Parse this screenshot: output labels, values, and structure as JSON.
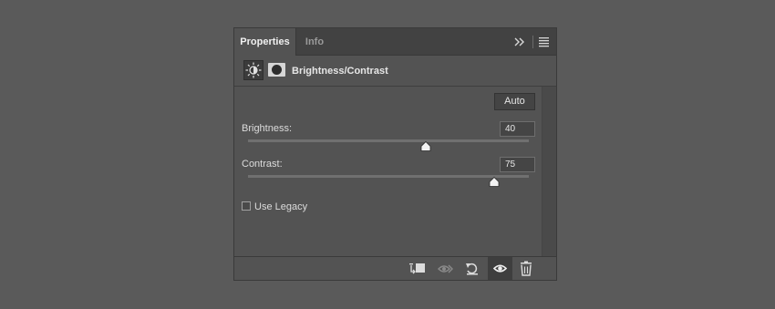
{
  "tabs": [
    {
      "label": "Properties",
      "active": true
    },
    {
      "label": "Info",
      "active": false
    }
  ],
  "panel_controls": {
    "collapse_icon": "double-chevron-right-icon",
    "menu_icon": "hamburger-menu-icon"
  },
  "adjustment": {
    "icon": "brightness-sun-icon",
    "mask_icon": "layer-mask-icon",
    "title": "Brightness/Contrast"
  },
  "auto_label": "Auto",
  "brightness": {
    "label": "Brightness:",
    "value": "40",
    "fraction": 0.632
  },
  "contrast": {
    "label": "Contrast:",
    "value": "75",
    "fraction": 0.875
  },
  "use_legacy": {
    "label": "Use Legacy",
    "checked": false
  },
  "bottom_toolbar": [
    {
      "icon": "clip-to-layer-icon"
    },
    {
      "icon": "view-previous-state-icon"
    },
    {
      "icon": "reset-icon"
    },
    {
      "icon": "visibility-eye-icon"
    },
    {
      "icon": "trash-icon"
    }
  ],
  "colors": {
    "panel": "#535353",
    "tabbar": "#424242",
    "background": "#5a5a5a"
  }
}
